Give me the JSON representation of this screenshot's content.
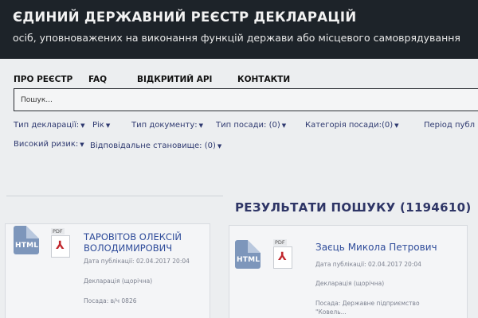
{
  "header": {
    "title": "ЄДИНИЙ ДЕРЖАВНИЙ РЕЄСТР ДЕКЛАРАЦІЙ",
    "subtitle": "осіб, уповноважених на виконання функцій держави або місцевого самоврядування"
  },
  "nav": {
    "items": [
      "ПРО РЕЄСТР",
      "FAQ",
      "ВІДКРИТИЙ API",
      "КОНТАКТИ"
    ]
  },
  "search": {
    "value": "",
    "placeholder": "Пошук..."
  },
  "filters": {
    "row1": [
      {
        "label": "Тип декларації:"
      },
      {
        "label": "Рік"
      },
      {
        "label": "Тип документу:"
      },
      {
        "label": "Тип посади: (0)"
      },
      {
        "label": "Категорія посади:(0)"
      },
      {
        "label": "Період публ"
      }
    ],
    "row2": [
      {
        "label": "Високий ризик:"
      },
      {
        "label": "Відповідальне становище: (0)"
      }
    ]
  },
  "results": {
    "title": "РЕЗУЛЬТАТИ ПОШУКУ (1194610)",
    "items": [
      {
        "html_label": "HTML",
        "pdf_label": "PDF",
        "name_line1": "ТАРОВІТОВ ОЛЕКСІЙ",
        "name_line2": "ВОЛОДИМИРОВИЧ",
        "published": "Дата публікації: 02.04.2017 20:04",
        "type": "Декларація (щорічна)",
        "position": "Посада: в/ч 0826"
      },
      {
        "html_label": "HTML",
        "pdf_label": "PDF",
        "name_line1": "Заєць Микола Петрович",
        "name_line2": "",
        "published": "Дата публікації: 02.04.2017 20:04",
        "type": "Декларація (щорічна)",
        "position": "Посада: Державне підприємство",
        "position_line2": "\"Ковель..."
      }
    ]
  },
  "colors": {
    "header_bg": "#1d2329",
    "link_blue": "#2f4c9a",
    "filter_text": "#2f3a70",
    "pdf_red": "#c1272d"
  },
  "icons": [
    "html-file-icon",
    "pdf-file-icon",
    "acrobat-icon",
    "caret-down-icon"
  ]
}
